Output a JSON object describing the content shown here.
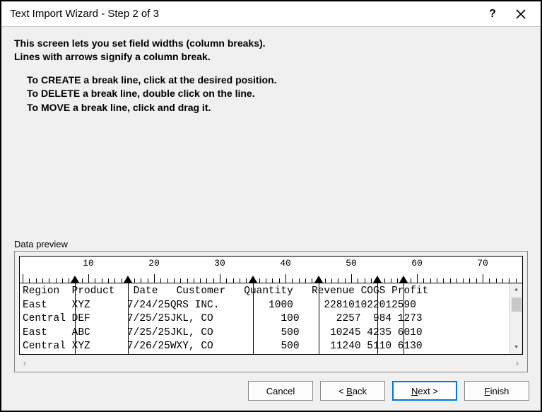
{
  "title": "Text Import Wizard - Step 2 of 3",
  "intro": {
    "line1": "This screen lets you set field widths (column breaks).",
    "line2": "Lines with arrows signify a column break."
  },
  "instructions": {
    "create": "To CREATE a break line, click at the desired position.",
    "delete": "To DELETE a break line, double click on the line.",
    "move": "To MOVE a break line, click and drag it."
  },
  "preview_label": "Data preview",
  "ruler": {
    "labels": [
      10,
      20,
      30,
      40,
      50,
      60,
      70
    ]
  },
  "breaks": [
    8,
    16,
    35,
    45,
    54,
    58
  ],
  "char_width": 9.3,
  "data_rows": [
    "Region  Product   Date   Customer   Quantity   Revenue COGS Profit",
    "East    XYZ      7/24/25QRS INC.        1000     228101022012590",
    "Central DEF      7/25/25JKL, CO           100      2257  984 1273",
    "East    ABC      7/25/25JKL, CO           500     10245 4235 6010",
    "Central XYZ      7/26/25WXY, CO           500     11240 5110 6130"
  ],
  "buttons": {
    "cancel": "Cancel",
    "back_prefix": "< ",
    "back_mn": "B",
    "back_rest": "ack",
    "next_mn": "N",
    "next_rest": "ext >",
    "finish_mn": "F",
    "finish_rest": "inish"
  }
}
